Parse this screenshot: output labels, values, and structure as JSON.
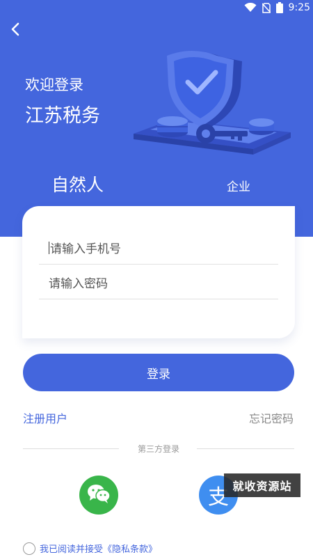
{
  "status": {
    "time": "9:25",
    "icons": [
      "wifi-icon",
      "no-sim-icon",
      "battery-icon"
    ]
  },
  "header": {
    "back_icon": "chevron-left-icon",
    "welcome": "欢迎登录",
    "title": "江苏税务"
  },
  "tabs": {
    "person": "自然人",
    "company": "企业"
  },
  "form": {
    "phone_placeholder": "请输入手机号",
    "password_placeholder": "请输入密码"
  },
  "actions": {
    "login": "登录",
    "register": "注册用户",
    "forgot": "忘记密码"
  },
  "third_party": {
    "label": "第三方登录",
    "wechat_icon": "wechat-icon",
    "alipay_glyph": "支"
  },
  "watermark": "就收资源站",
  "agreement": {
    "text": "我已阅读并接受《隐私条款》"
  },
  "colors": {
    "primary": "#4466dd",
    "wechat": "#39b54a",
    "alipay": "#3f8ef0"
  }
}
